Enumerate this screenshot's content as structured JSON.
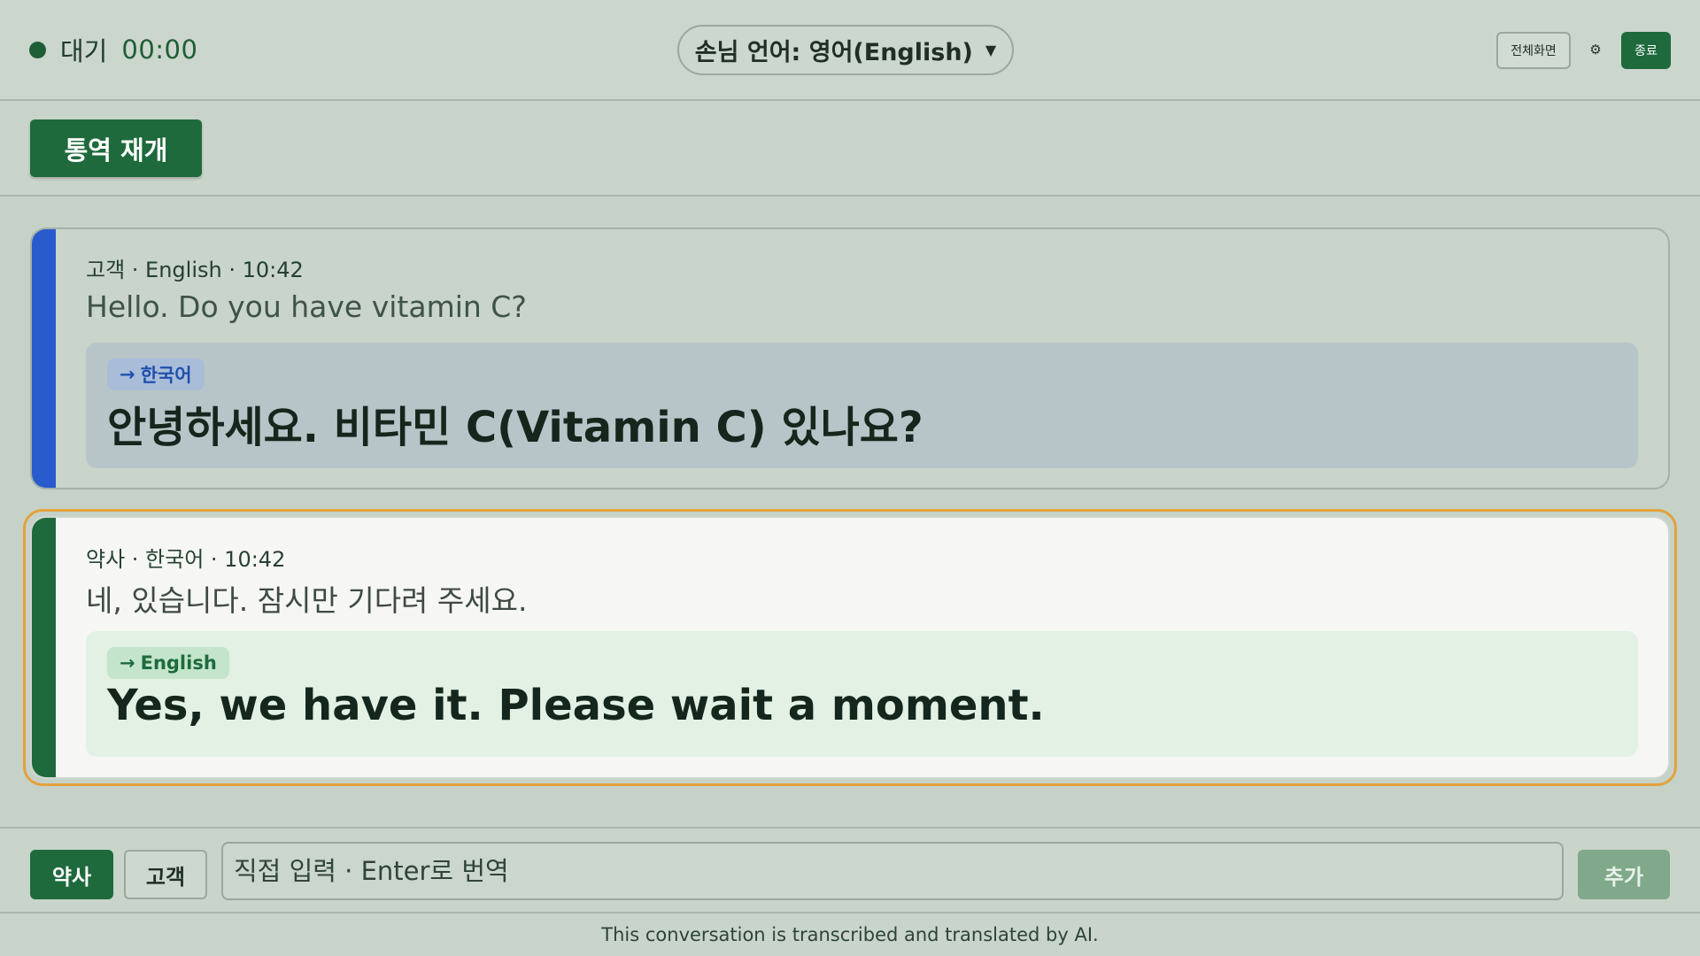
{
  "header": {
    "status_label": "대기",
    "timer": "00:00",
    "language_select": "손님 언어: 영어(English)",
    "fullscreen_label": "전체화면",
    "end_label": "종료"
  },
  "controls": {
    "resume_label": "통역 재개"
  },
  "messages": [
    {
      "meta": "고객 · English · 10:42",
      "original": "Hello. Do you have vitamin C?",
      "target_tag": "한국어",
      "translation": "안녕하세요. 비타민 C(Vitamin C) 있나요?"
    },
    {
      "meta": "약사 · 한국어 · 10:42",
      "original": "네, 있습니다. 잠시만 기다려 주세요.",
      "target_tag": "English",
      "translation": "Yes, we have it. Please wait a moment."
    }
  ],
  "input_bar": {
    "pharmacist_label": "약사",
    "customer_label": "고객",
    "placeholder": "직접 입력 · Enter로 번역",
    "value": "",
    "add_label": "추가"
  },
  "footer": {
    "notice": "This conversation is transcribed and translated by AI."
  },
  "colors": {
    "primary_green": "#1e6a3c",
    "customer_accent": "#2a5bcc",
    "active_highlight": "#e3a23c"
  }
}
